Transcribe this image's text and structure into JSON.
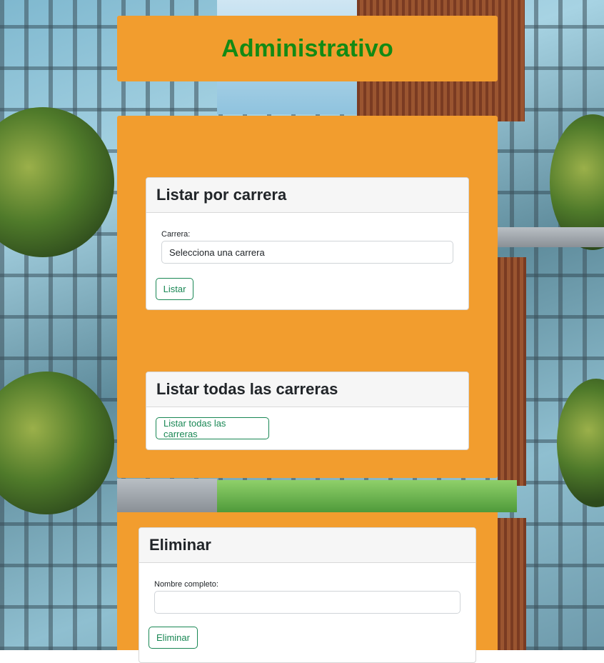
{
  "header": {
    "title": "Administrativo"
  },
  "listar_por_carrera": {
    "title": "Listar por carrera",
    "field_label": "Carrera:",
    "select_value": "Selecciona una carrera",
    "button_label": "Listar"
  },
  "listar_todas": {
    "title": "Listar todas las carreras",
    "button_label": "Listar todas las carreras"
  },
  "eliminar": {
    "title": "Eliminar",
    "field_label": "Nombre completo:",
    "input_value": "",
    "button_label": "Eliminar"
  },
  "colors": {
    "panel": "#f29d2e",
    "header_title": "#138a14",
    "button_accent": "#198754"
  }
}
